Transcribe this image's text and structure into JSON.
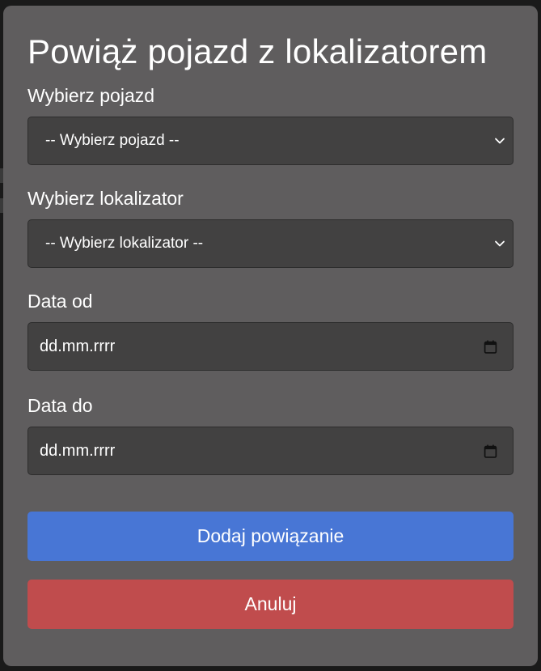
{
  "modal": {
    "title": "Powiąż pojazd z lokalizatorem",
    "vehicle_field": {
      "label": "Wybierz pojazd",
      "selected": "-- Wybierz pojazd --"
    },
    "locator_field": {
      "label": "Wybierz lokalizator",
      "selected": "-- Wybierz lokalizator --"
    },
    "date_from_field": {
      "label": "Data od",
      "placeholder": "dd.mm.rrrr"
    },
    "date_to_field": {
      "label": "Data do",
      "placeholder": "dd.mm.rrrr"
    },
    "submit_label": "Dodaj powiązanie",
    "cancel_label": "Anuluj"
  },
  "colors": {
    "modal_background": "#5f5d5e",
    "input_background": "#424141",
    "primary_button": "#4876d5",
    "danger_button": "#c04c4d"
  },
  "icons": {
    "select_arrow": "chevron-down-icon",
    "date_picker": "calendar-icon"
  }
}
